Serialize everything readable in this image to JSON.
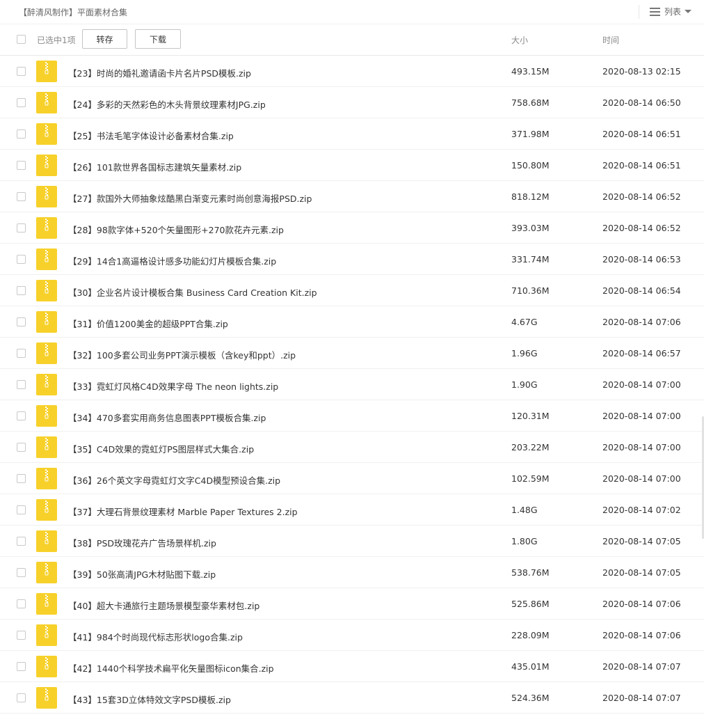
{
  "breadcrumb": "【醉清风制作】平面素材合集",
  "view_toggle": {
    "label": "列表",
    "icon": "list-icon"
  },
  "toolbar": {
    "selected_text": "已选中1项",
    "transfer_label": "转存",
    "download_label": "下载",
    "size_header": "大小",
    "time_header": "时间"
  },
  "colors": {
    "zip_icon": "#f7d12a",
    "accent": "#333333"
  },
  "files": [
    {
      "name": "【23】时尚的婚礼邀请函卡片名片PSD模板.zip",
      "size": "493.15M",
      "time": "2020-08-13 02:15"
    },
    {
      "name": "【24】多彩的天然彩色的木头背景纹理素材JPG.zip",
      "size": "758.68M",
      "time": "2020-08-14 06:50"
    },
    {
      "name": "【25】书法毛笔字体设计必备素材合集.zip",
      "size": "371.98M",
      "time": "2020-08-14 06:51"
    },
    {
      "name": "【26】101款世界各国标志建筑矢量素材.zip",
      "size": "150.80M",
      "time": "2020-08-14 06:51"
    },
    {
      "name": "【27】款国外大师抽象炫酷黑白渐变元素时尚创意海报PSD.zip",
      "size": "818.12M",
      "time": "2020-08-14 06:52"
    },
    {
      "name": "【28】98款字体+520个矢量图形+270款花卉元素.zip",
      "size": "393.03M",
      "time": "2020-08-14 06:52"
    },
    {
      "name": "【29】14合1高逼格设计感多功能幻灯片模板合集.zip",
      "size": "331.74M",
      "time": "2020-08-14 06:53"
    },
    {
      "name": "【30】企业名片设计模板合集 Business Card Creation Kit.zip",
      "size": "710.36M",
      "time": "2020-08-14 06:54"
    },
    {
      "name": "【31】价值1200美金的超级PPT合集.zip",
      "size": "4.67G",
      "time": "2020-08-14 07:06"
    },
    {
      "name": "【32】100多套公司业务PPT演示模板（含key和ppt）.zip",
      "size": "1.96G",
      "time": "2020-08-14 06:57"
    },
    {
      "name": "【33】霓虹灯风格C4D效果字母 The neon lights.zip",
      "size": "1.90G",
      "time": "2020-08-14 07:00"
    },
    {
      "name": "【34】470多套实用商务信息图表PPT模板合集.zip",
      "size": "120.31M",
      "time": "2020-08-14 07:00"
    },
    {
      "name": "【35】C4D效果的霓虹灯PS图层样式大集合.zip",
      "size": "203.22M",
      "time": "2020-08-14 07:00"
    },
    {
      "name": "【36】26个英文字母霓虹灯文字C4D模型预设合集.zip",
      "size": "102.59M",
      "time": "2020-08-14 07:00"
    },
    {
      "name": "【37】大理石背景纹理素材 Marble Paper Textures 2.zip",
      "size": "1.48G",
      "time": "2020-08-14 07:02"
    },
    {
      "name": "【38】PSD玫瑰花卉广告场景样机.zip",
      "size": "1.80G",
      "time": "2020-08-14 07:05"
    },
    {
      "name": "【39】50张高清JPG木材贴图下载.zip",
      "size": "538.76M",
      "time": "2020-08-14 07:05"
    },
    {
      "name": "【40】超大卡通旅行主题场景模型豪华素材包.zip",
      "size": "525.86M",
      "time": "2020-08-14 07:06"
    },
    {
      "name": "【41】984个时尚现代标志形状logo合集.zip",
      "size": "228.09M",
      "time": "2020-08-14 07:06"
    },
    {
      "name": "【42】1440个科学技术扁平化矢量图标icon集合.zip",
      "size": "435.01M",
      "time": "2020-08-14 07:07"
    },
    {
      "name": "【43】15套3D立体特效文字PSD模板.zip",
      "size": "524.36M",
      "time": "2020-08-14 07:07"
    }
  ]
}
